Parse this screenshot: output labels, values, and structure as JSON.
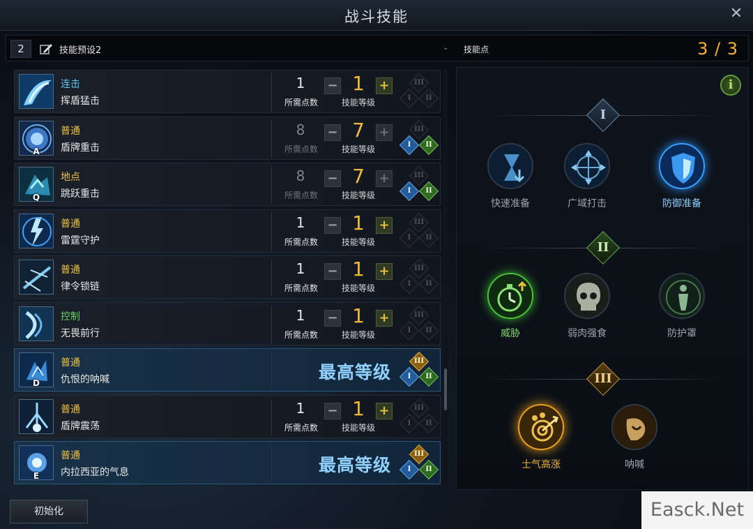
{
  "window": {
    "title": "战斗技能",
    "close_glyph": "✕"
  },
  "preset": {
    "number": "2",
    "name": "技能预设2",
    "points_label": "技能点",
    "points_value": "3 / 3"
  },
  "labels": {
    "required_points": "所需点数",
    "skill_level": "技能等级",
    "max_level": "最高等级"
  },
  "skills": [
    {
      "type": "连击",
      "type_color": "#5ec8f0",
      "name": "挥盾猛击",
      "key": "",
      "required": "1",
      "required_dim": false,
      "level": "1",
      "plus_enabled": true,
      "max": false,
      "tripods": [
        false,
        false,
        false
      ],
      "icon": "shield-slash-icon"
    },
    {
      "type": "普通",
      "type_color": "#f0c040",
      "name": "盾牌重击",
      "key": "A",
      "required": "8",
      "required_dim": true,
      "level": "7",
      "plus_enabled": false,
      "max": false,
      "tripods": [
        true,
        true,
        false
      ],
      "icon": "shield-bash-icon"
    },
    {
      "type": "地点",
      "type_color": "#f0c040",
      "name": "跳跃重击",
      "key": "Q",
      "required": "8",
      "required_dim": true,
      "level": "7",
      "plus_enabled": false,
      "max": false,
      "tripods": [
        true,
        true,
        false
      ],
      "icon": "leap-strike-icon"
    },
    {
      "type": "普通",
      "type_color": "#f0c040",
      "name": "雷霆守护",
      "key": "",
      "required": "1",
      "required_dim": false,
      "level": "1",
      "plus_enabled": true,
      "max": false,
      "tripods": [
        false,
        false,
        false
      ],
      "icon": "thunder-guard-icon"
    },
    {
      "type": "普通",
      "type_color": "#f0c040",
      "name": "律令锁链",
      "key": "",
      "required": "1",
      "required_dim": false,
      "level": "1",
      "plus_enabled": true,
      "max": false,
      "tripods": [
        false,
        false,
        false
      ],
      "icon": "chain-icon"
    },
    {
      "type": "控制",
      "type_color": "#6ad060",
      "name": "无畏前行",
      "key": "",
      "required": "1",
      "required_dim": false,
      "level": "1",
      "plus_enabled": true,
      "max": false,
      "tripods": [
        false,
        false,
        false
      ],
      "icon": "charge-icon"
    },
    {
      "type": "普通",
      "type_color": "#f0c040",
      "name": "仇恨的呐喊",
      "key": "D",
      "required": "",
      "required_dim": false,
      "level": "",
      "plus_enabled": false,
      "max": true,
      "tripods": [
        true,
        true,
        true
      ],
      "icon": "war-cry-icon"
    },
    {
      "type": "普通",
      "type_color": "#f0c040",
      "name": "盾牌震荡",
      "key": "",
      "required": "1",
      "required_dim": false,
      "level": "1",
      "plus_enabled": true,
      "max": false,
      "tripods": [
        false,
        false,
        false
      ],
      "icon": "shield-shock-icon"
    },
    {
      "type": "普通",
      "type_color": "#f0c040",
      "name": "内拉西亚的气息",
      "key": "E",
      "required": "",
      "required_dim": false,
      "level": "",
      "plus_enabled": false,
      "max": true,
      "tripods": [
        true,
        true,
        true
      ],
      "icon": "nella-breath-icon"
    }
  ],
  "tripod_numerals": [
    "I",
    "II",
    "III"
  ],
  "engravings": {
    "info_glyph": "i",
    "tiers": [
      {
        "numeral": "I",
        "options": [
          {
            "label": "快速准备",
            "selected": false,
            "icon": "hourglass-icon"
          },
          {
            "label": "广域打击",
            "selected": false,
            "icon": "wide-strike-icon"
          },
          {
            "label": "防御准备",
            "selected": true,
            "icon": "defense-shield-icon"
          }
        ]
      },
      {
        "numeral": "II",
        "options": [
          {
            "label": "威胁",
            "selected": true,
            "icon": "stopwatch-icon"
          },
          {
            "label": "弱肉强食",
            "selected": false,
            "icon": "skull-icon"
          },
          {
            "label": "防护罩",
            "selected": false,
            "icon": "barrier-figure-icon"
          }
        ]
      },
      {
        "numeral": "III",
        "options": [
          {
            "label": "士气高涨",
            "selected": true,
            "icon": "morale-icon"
          },
          {
            "label": "呐喊",
            "selected": false,
            "icon": "shout-icon"
          }
        ]
      }
    ]
  },
  "footer": {
    "reset_label": "初始化",
    "watermark": "Easck.Net"
  }
}
